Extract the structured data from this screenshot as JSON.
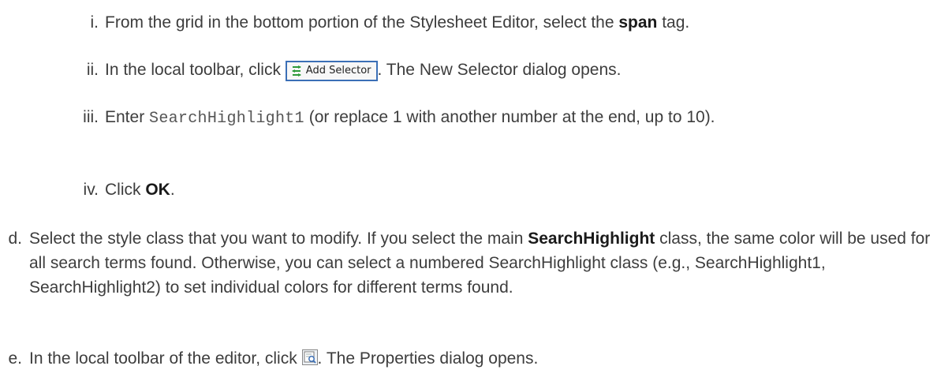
{
  "steps": {
    "i": {
      "marker": "i.",
      "t1": "From the grid in the bottom portion of the Stylesheet Editor, select the ",
      "b1": "span",
      "t2": " tag."
    },
    "ii": {
      "marker": "ii.",
      "t1": "In the local toolbar, click ",
      "button_label": "Add Selector",
      "t2": ". The New Selector dialog opens."
    },
    "iii": {
      "marker": "iii.",
      "t1": "Enter ",
      "code": "SearchHighlight1",
      "t2": " (or replace 1 with another number at the end, up to 10)."
    },
    "iv": {
      "marker": "iv.",
      "t1": "Click ",
      "b1": "OK",
      "t2": "."
    },
    "d": {
      "marker": "d.",
      "t1": "Select the style class that you want to modify. If you select the main ",
      "b1": "SearchHighlight",
      "t2": " class, the same color will be used for all search terms found. Otherwise, you can select a numbered SearchHighlight class (e.g., SearchHighlight1, SearchHighlight2) to set individual colors for different terms found."
    },
    "e": {
      "marker": "e.",
      "t1": "In the local toolbar of the editor, click ",
      "t2": ". The Properties dialog opens."
    }
  },
  "icons": {
    "add_selector": "add-selector-icon",
    "properties": "properties-icon"
  },
  "colors": {
    "text": "#3d3d3d",
    "bold": "#1a1a1a",
    "button_border": "#3b6fb6",
    "icon_green": "#2e9a3a"
  }
}
